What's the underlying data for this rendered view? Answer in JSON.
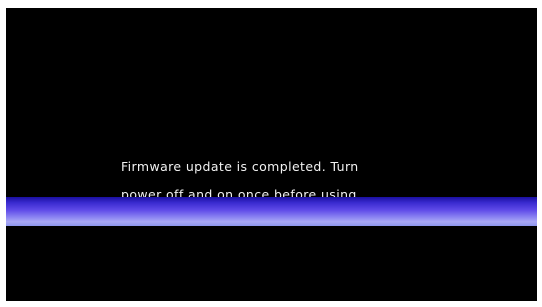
{
  "screen": {
    "background_color": "#000000",
    "message": {
      "line1": "Firmware update is completed. Turn",
      "line2": "power off and on once before using."
    },
    "band_colors": {
      "top": "#1a0fa0",
      "middle": "#5f4ae8",
      "bottom": "#a9a8f4"
    }
  }
}
